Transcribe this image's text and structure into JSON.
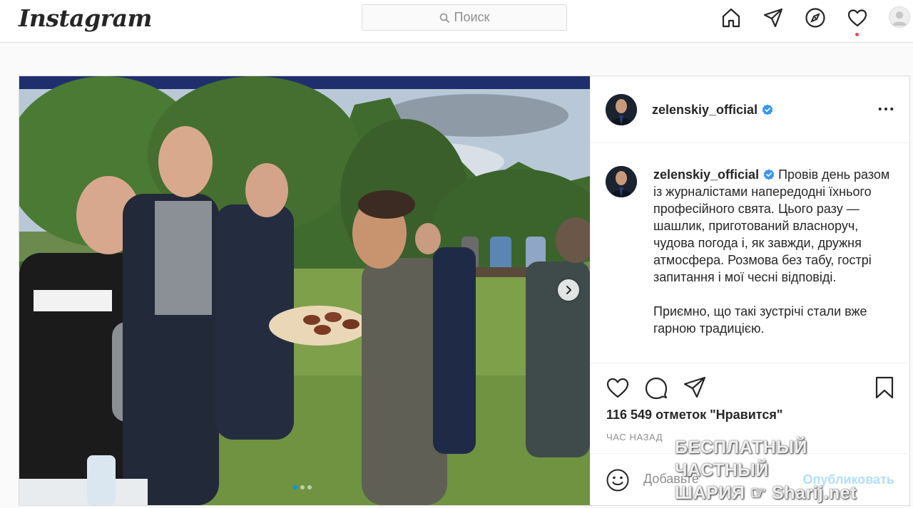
{
  "topnav": {
    "logo": "Instagram",
    "search_placeholder": "Поиск"
  },
  "post": {
    "author": "zelenskiy_official",
    "caption_paragraphs": [
      "Провів день разом із журналістами напередодні їхнього професійного свята. Цього разу — шашлик, приготований власноруч, чудова погода і, як завжди, дружня атмосфера. Розмова без табу, гострі запитання і мої чесні відповіді.",
      "Приємно, що такі зустрічі стали вже гарною традицією."
    ],
    "likes": "116 549 отметок \"Нравится\"",
    "time": "ЧАС НАЗАД",
    "comment_placeholder": "Добавьте",
    "publish_label": "Опубликовать",
    "carousel": {
      "count": 3,
      "active_index": 0
    }
  },
  "watermark": {
    "line1": "БЕСПЛАТНЫЙ ЧАСТНЫЙ",
    "line2": "ШАРИЯ",
    "line3": "Sharij.net"
  },
  "colors": {
    "accent": "#0095f6",
    "verified": "#3897f0",
    "notification": "#ed4956",
    "border": "#dbdbdb"
  },
  "icons": [
    "search-icon",
    "home-icon",
    "direct-icon",
    "explore-icon",
    "heart-icon",
    "profile-avatar",
    "verified-badge-icon",
    "more-options-icon",
    "like-icon",
    "comment-icon",
    "share-icon",
    "save-icon",
    "emoji-icon",
    "chevron-right-icon"
  ]
}
